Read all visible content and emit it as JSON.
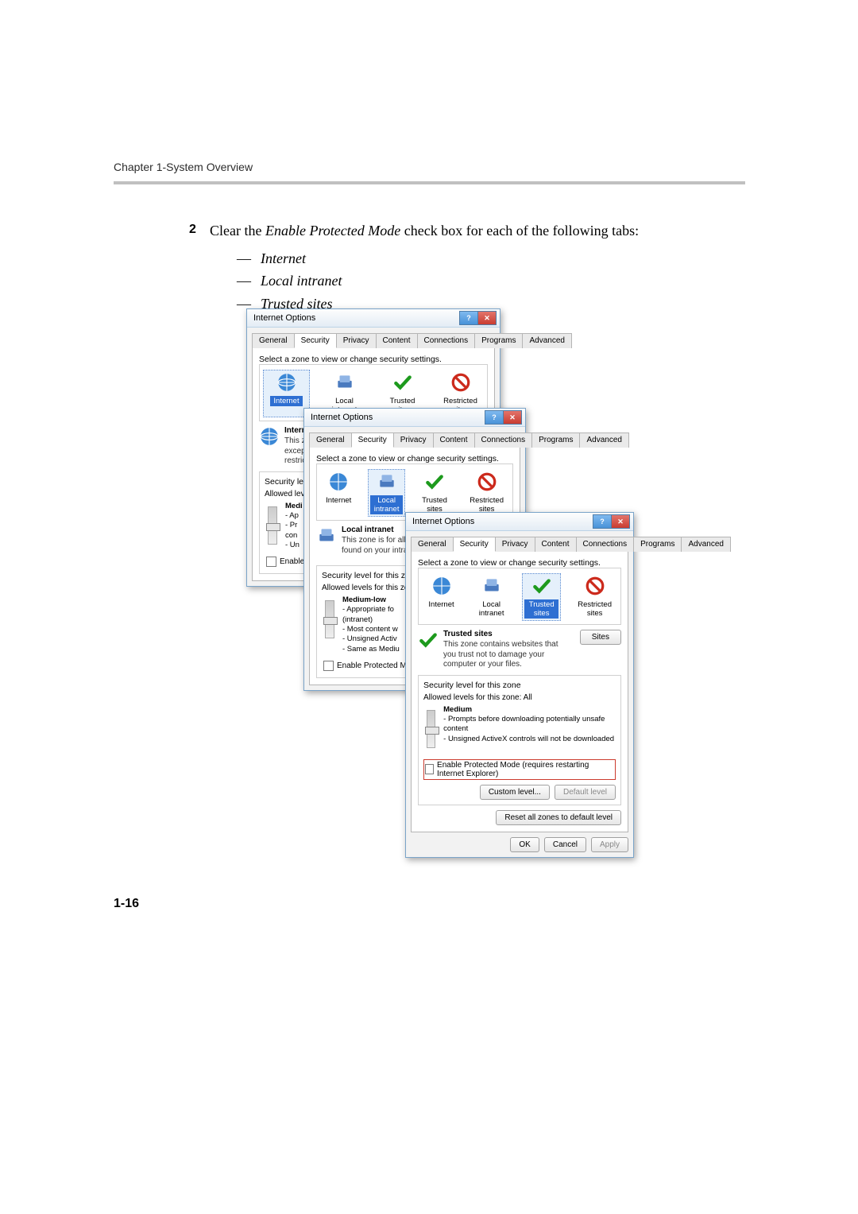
{
  "chapter": "Chapter 1-System Overview",
  "step": {
    "number": "2",
    "text_before": "Clear the ",
    "text_em": "Enable Protected Mode",
    "text_after": " check box for each of the following tabs:",
    "bullets": [
      "Internet",
      "Local intranet",
      "Trusted sites"
    ]
  },
  "page_number": "1-16",
  "common": {
    "title": "Internet Options",
    "tabs": [
      "General",
      "Security",
      "Privacy",
      "Content",
      "Connections",
      "Programs",
      "Advanced"
    ],
    "active_tab": "Security",
    "select_zone_label": "Select a zone to view or change security settings.",
    "zones": [
      "Internet",
      "Local intranet",
      "Trusted sites",
      "Restricted sites"
    ],
    "ok": "OK",
    "cancel": "Cancel",
    "apply": "Apply",
    "custom_level": "Custom level...",
    "default_level": "Default level",
    "reset_all": "Reset all zones to default level",
    "sec_level_label": "Security level for this zone",
    "allowed_prefix": "Allowed levels for this zone:",
    "enable_pm_full": "Enable Protected Mode (requires restarting Internet Explorer)",
    "sites_btn": "Sites"
  },
  "d1": {
    "zone_name": "Internet",
    "desc1": "This zone",
    "desc2": "except th",
    "desc3": "restricted",
    "sec_level_fragment": "Security level for",
    "allowed_fragment": "Allowed levels f",
    "level_name": "Medi",
    "l1": "- Ap",
    "l2": "- Pr",
    "l3": "con",
    "l4": "- Un",
    "enable_pm_short": "Enable Pro"
  },
  "d2": {
    "zone_name": "Local intranet",
    "desc1": "This zone is for all we",
    "desc2": "found on your intrane",
    "allowed_fragment": "Allowed levels for this zone:",
    "level_name": "Medium-low",
    "l1": "- Appropriate fo",
    "l2": "(intranet)",
    "l3": "- Most content w",
    "l4": "- Unsigned Activ",
    "l5": "- Same as Mediu",
    "enable_pm_short": "Enable Protected Mode"
  },
  "d3": {
    "zone_name": "Trusted sites",
    "desc": "This zone contains websites that you trust not to damage your computer or your files.",
    "allowed": "Allowed levels for this zone: All",
    "level_name": "Medium",
    "l1": "- Prompts before downloading potentially unsafe content",
    "l2": "- Unsigned ActiveX controls will not be downloaded"
  }
}
